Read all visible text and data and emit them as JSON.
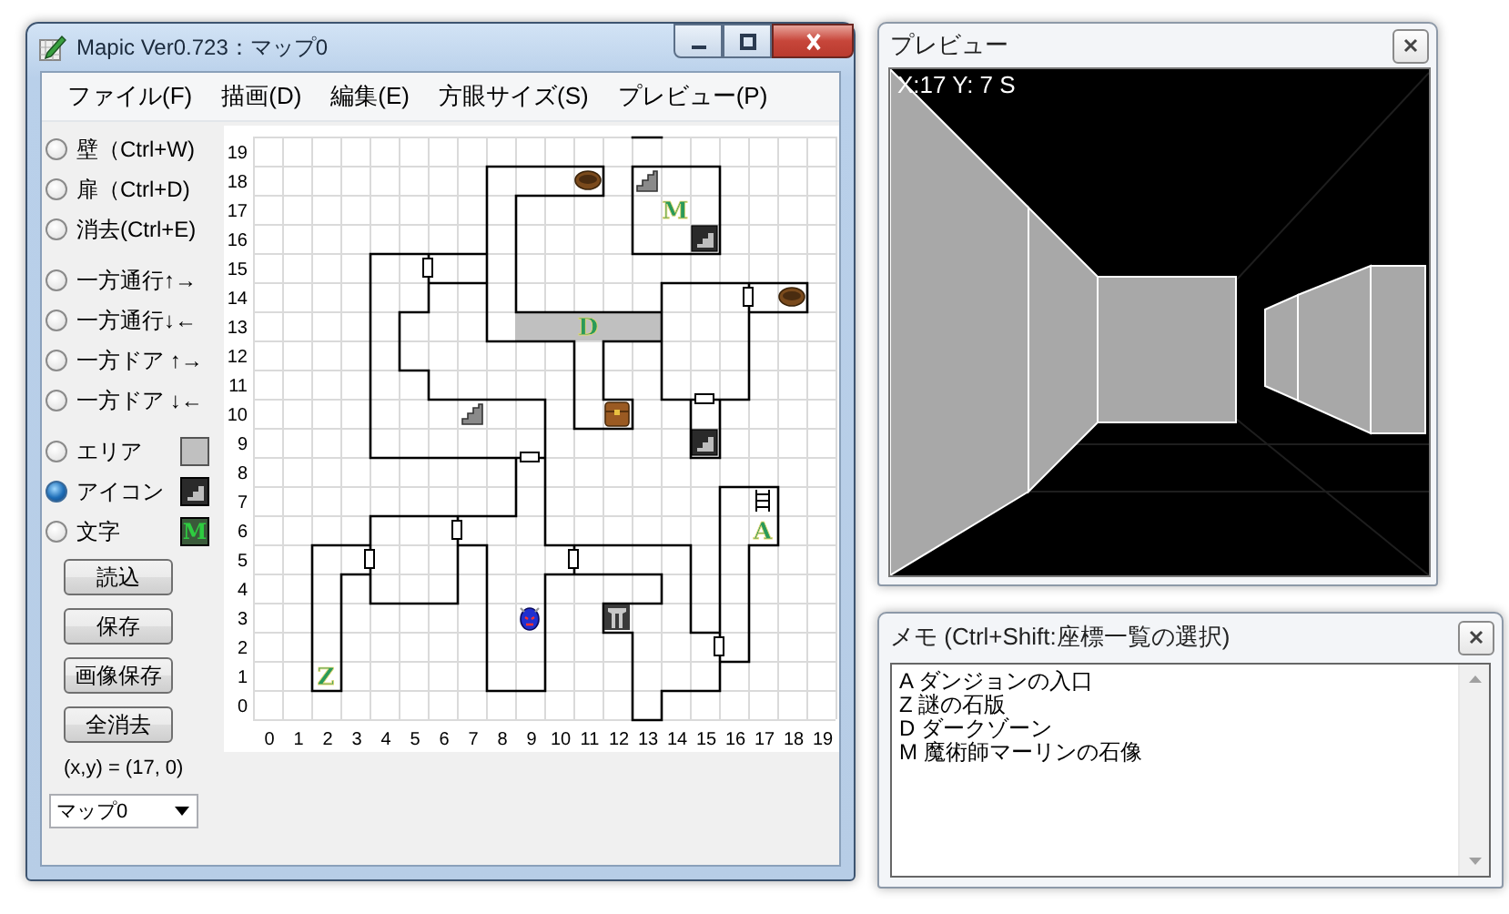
{
  "main_window": {
    "title": "Mapic Ver0.723：マップ0",
    "menu": [
      "ファイル(F)",
      "描画(D)",
      "編集(E)",
      "方眼サイズ(S)",
      "プレビュー(P)"
    ],
    "tool_groups": [
      {
        "items": [
          {
            "label": "壁（Ctrl+W)",
            "selected": false
          },
          {
            "label": "扉（Ctrl+D)",
            "selected": false
          },
          {
            "label": "消去(Ctrl+E)",
            "selected": false
          }
        ]
      },
      {
        "items": [
          {
            "label": "一方通行↑→",
            "selected": false
          },
          {
            "label": "一方通行↓←",
            "selected": false
          },
          {
            "label": "一方ドア ↑→",
            "selected": false
          },
          {
            "label": "一方ドア ↓←",
            "selected": false
          }
        ]
      },
      {
        "items": [
          {
            "label": "エリア",
            "selected": false,
            "swatch": {
              "kind": "area"
            }
          },
          {
            "label": "アイコン",
            "selected": true,
            "swatch": {
              "kind": "icon"
            }
          },
          {
            "label": "文字",
            "selected": false,
            "swatch": {
              "kind": "text",
              "text": "M"
            }
          }
        ]
      }
    ],
    "buttons": [
      "読込",
      "保存",
      "画像保存",
      "全消去"
    ],
    "coordinates": "(x,y) = (17, 0)",
    "map_select": "マップ0",
    "map": {
      "y_axis": [
        "19",
        "18",
        "17",
        "16",
        "15",
        "14",
        "13",
        "12",
        "11",
        "10",
        "9",
        "8",
        "7",
        "6",
        "5",
        "4",
        "3",
        "2",
        "1",
        "0"
      ],
      "x_axis": [
        "0",
        "1",
        "2",
        "3",
        "4",
        "5",
        "6",
        "7",
        "8",
        "9",
        "10",
        "11",
        "12",
        "13",
        "14",
        "15",
        "16",
        "17",
        "18",
        "19"
      ],
      "labels": [
        "M",
        "D",
        "A",
        "Z"
      ]
    }
  },
  "preview": {
    "title": "プレビュー",
    "position": "X:17 Y: 7 S"
  },
  "memo": {
    "title": "メモ (Ctrl+Shift:座標一覧の選択)",
    "lines": [
      "A ダンジョンの入口",
      "Z 謎の石版",
      "D ダークゾーン",
      "M 魔術師マーリンの石像"
    ]
  }
}
